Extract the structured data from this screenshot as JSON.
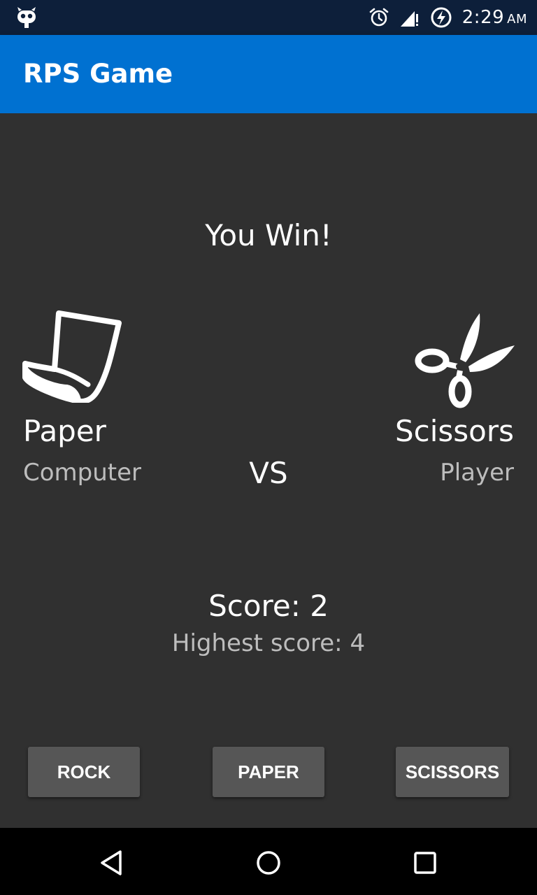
{
  "status_bar": {
    "time": "2:29",
    "ampm": "AM",
    "icons": [
      "cyanogen-robot-icon",
      "alarm-icon",
      "signal-icon",
      "battery-charging-icon"
    ]
  },
  "app_bar": {
    "title": "RPS Game",
    "color": "#0071d1"
  },
  "game": {
    "result": "You Win!",
    "vs": "VS",
    "computer": {
      "choice": "Paper",
      "label": "Computer",
      "icon": "paper-icon"
    },
    "player": {
      "choice": "Scissors",
      "label": "Player",
      "icon": "scissors-icon"
    },
    "score": "Score: 2",
    "highest_score": "Highest score: 4"
  },
  "buttons": {
    "rock": "ROCK",
    "paper": "PAPER",
    "scissors": "SCISSORS"
  },
  "nav_bar": {
    "icons": [
      "back-icon",
      "home-icon",
      "recents-icon"
    ]
  }
}
